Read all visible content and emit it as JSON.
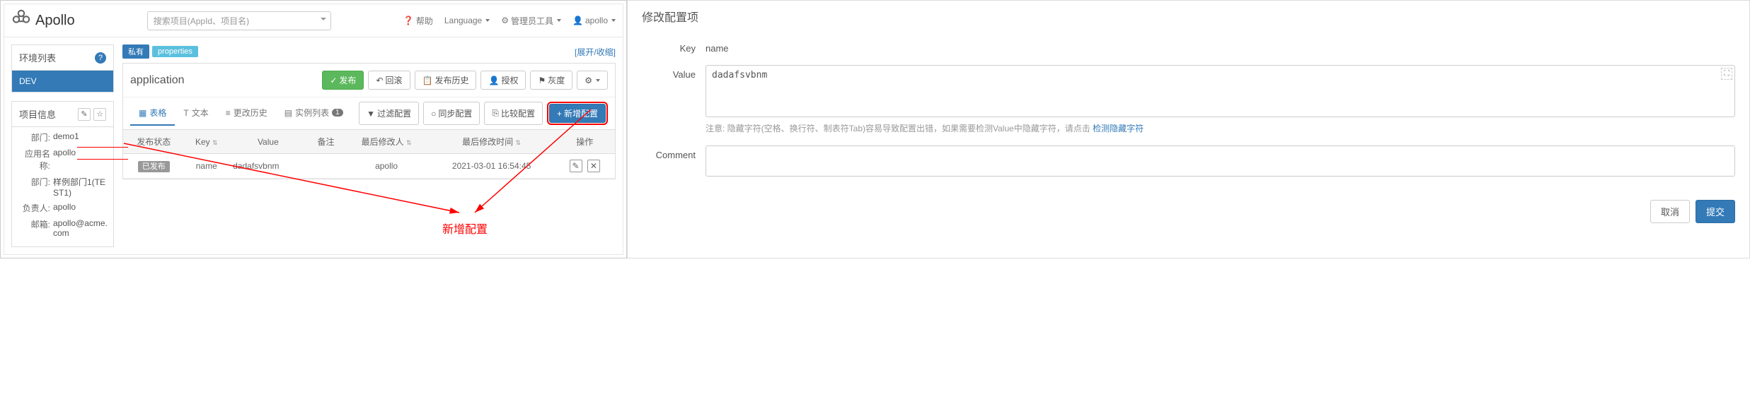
{
  "logo": {
    "text": "Apollo"
  },
  "search": {
    "placeholder": "搜索项目(AppId、项目名)"
  },
  "nav": {
    "help": "帮助",
    "language": "Language",
    "admin_tools": "管理员工具",
    "user": "apollo"
  },
  "sidebar": {
    "env_title": "环境列表",
    "envs": [
      "DEV"
    ],
    "proj_title": "项目信息",
    "proj_fields": [
      {
        "label": "部门:",
        "value": "demo1"
      },
      {
        "label": "应用名称:",
        "value": "apollo"
      },
      {
        "label": "部门:",
        "value": "样例部门1(TEST1)"
      },
      {
        "label": "负责人:",
        "value": "apollo"
      },
      {
        "label": "邮箱:",
        "value": "apollo@acme.com"
      }
    ]
  },
  "main": {
    "badges": {
      "private": "私有",
      "properties": "properties"
    },
    "expand": "[展开/收缩]",
    "namespace": "application",
    "actions": {
      "release": "发布",
      "rollback": "回滚",
      "history": "发布历史",
      "auth": "授权",
      "gray": "灰度"
    },
    "tabs": {
      "table": "表格",
      "text": "文本",
      "change_history": "更改历史",
      "instances": "实例列表",
      "instance_count": "1"
    },
    "toolbar": {
      "filter": "过滤配置",
      "sync": "同步配置",
      "compare": "比较配置",
      "add": "新增配置"
    },
    "table": {
      "headers": {
        "status": "发布状态",
        "key": "Key",
        "value": "Value",
        "remark": "备注",
        "modifier": "最后修改人",
        "modified_time": "最后修改时间",
        "ops": "操作"
      },
      "rows": [
        {
          "status": "已发布",
          "key": "name",
          "value": "dadafsvbnm",
          "remark": "",
          "modifier": "apollo",
          "modified_time": "2021-03-01 16:54:45"
        }
      ]
    }
  },
  "annotation": {
    "add_config": "新增配置"
  },
  "right_panel": {
    "title": "修改配置项",
    "key_label": "Key",
    "key_value": "name",
    "value_label": "Value",
    "value_value": "dadafsvbnm",
    "hint_prefix": "注意: 隐藏字符(空格、换行符、制表符Tab)容易导致配置出错，如果需要检测Value中隐藏字符，请点击 ",
    "hint_link": "检测隐藏字符",
    "comment_label": "Comment",
    "comment_value": "",
    "cancel": "取消",
    "submit": "提交"
  }
}
